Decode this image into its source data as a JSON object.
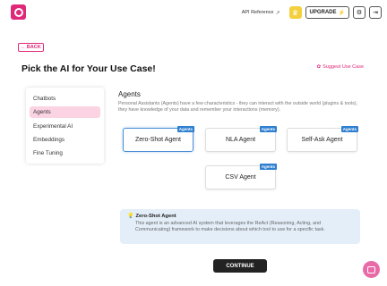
{
  "header": {
    "api_reference": "API Reference",
    "upgrade_label": "UPGRADE"
  },
  "back_label": "BACK",
  "page_title": "Pick the AI for Your Use Case!",
  "suggest_label": "Suggest Use Case",
  "sidebar": {
    "items": [
      {
        "label": "Chatbots"
      },
      {
        "label": "Agents"
      },
      {
        "label": "Experimental AI"
      },
      {
        "label": "Embeddings"
      },
      {
        "label": "Fine Tuning"
      }
    ]
  },
  "section": {
    "title": "Agents",
    "description": "Personal Assistants (Agents) have a few characteristics - they can interact with the outside world (plugins & tools), they have knowledge of your data and remember your interactions (memory)."
  },
  "cards": [
    {
      "label": "Zero-Shot Agent",
      "tag": "Agents"
    },
    {
      "label": "NLA Agent",
      "tag": "Agents"
    },
    {
      "label": "Self-Ask Agent",
      "tag": "Agents"
    },
    {
      "label": "CSV Agent",
      "tag": "Agents"
    }
  ],
  "info": {
    "title": "Zero-Shot Agent",
    "text": "This agent is an advanced AI system that leverages the ReAct (Reasoning, Acting, and Communicating) framework to make decisions about which tool to use for a specific task."
  },
  "continue_label": "CONTINUE"
}
